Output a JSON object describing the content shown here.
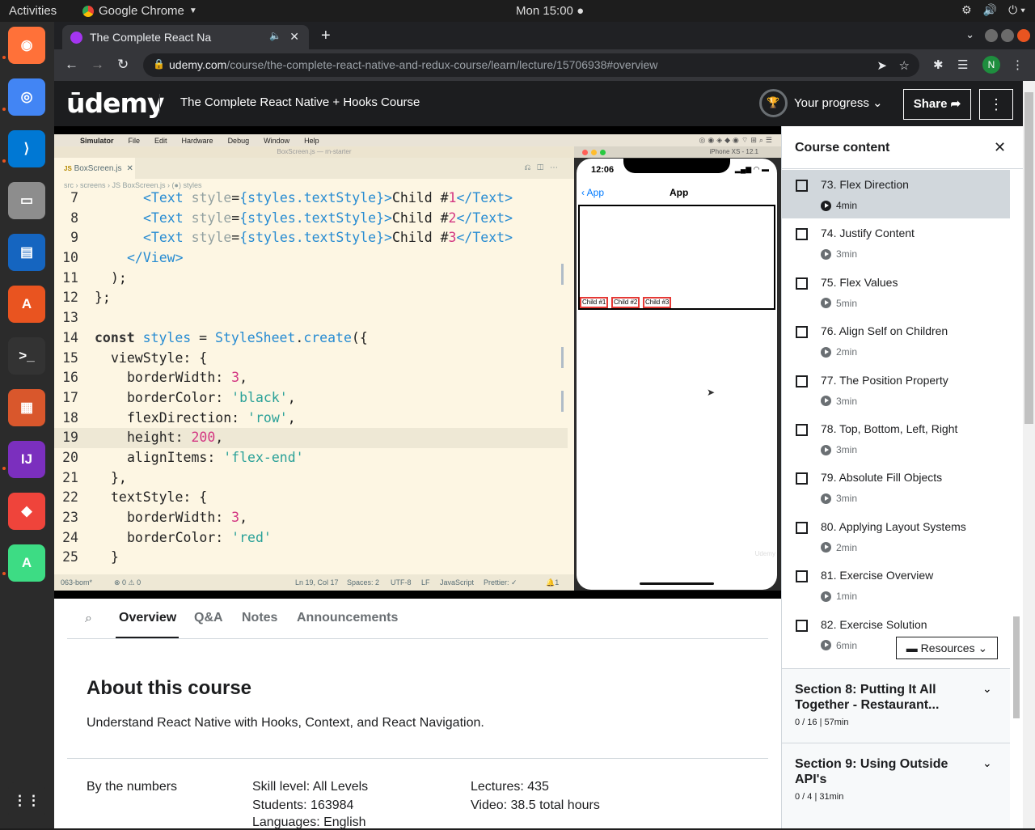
{
  "desktop": {
    "activities": "Activities",
    "app_name": "Google Chrome",
    "clock": "Mon 15:00",
    "dock": [
      {
        "name": "firefox-icon",
        "color": "#ff7139"
      },
      {
        "name": "chrome-icon",
        "color": "#4285f4"
      },
      {
        "name": "vscode-icon",
        "color": "#0078d4"
      },
      {
        "name": "files-icon",
        "color": "#8d8d8d"
      },
      {
        "name": "writer-icon",
        "color": "#1565c0"
      },
      {
        "name": "software-center-icon",
        "color": "#e95420"
      },
      {
        "name": "terminal-icon",
        "color": "#333333"
      },
      {
        "name": "archive-manager-icon",
        "color": "#d9572c"
      },
      {
        "name": "intellij-icon",
        "color": "#7b2fbe"
      },
      {
        "name": "anydesk-icon",
        "color": "#ef443b"
      },
      {
        "name": "android-studio-icon",
        "color": "#3ddc84"
      },
      {
        "name": "show-apps-icon",
        "color": "#2b2b2b"
      }
    ]
  },
  "browser": {
    "tab_title": "The Complete React Na",
    "new_tab": "+",
    "url_host": "udemy.com",
    "url_path": "/course/the-complete-react-native-and-redux-course/learn/lecture/15706938#overview",
    "profile_initial": "N"
  },
  "header": {
    "logo": "ūdemy",
    "course_title": "The Complete React Native + Hooks Course",
    "progress_label": "Your progress",
    "share_label": "Share"
  },
  "video": {
    "menubar": [
      "Simulator",
      "File",
      "Edit",
      "Hardware",
      "Debug",
      "Window",
      "Help"
    ],
    "editor_window_title": "BoxScreen.js — rn-starter",
    "editor_tab": "BoxScreen.js",
    "breadcrumb": "src › screens › JS BoxScreen.js › (●) styles",
    "code_lines": [
      {
        "n": "7",
        "text": "<Text style={styles.textStyle}>Child #1</Text>"
      },
      {
        "n": "8",
        "text": "<Text style={styles.textStyle}>Child #2</Text>"
      },
      {
        "n": "9",
        "text": "<Text style={styles.textStyle}>Child #3</Text>"
      },
      {
        "n": "10",
        "text": "</View>"
      },
      {
        "n": "11",
        "text": ");"
      },
      {
        "n": "12",
        "text": "};"
      },
      {
        "n": "13",
        "text": ""
      },
      {
        "n": "14",
        "text": "const styles = StyleSheet.create({"
      },
      {
        "n": "15",
        "text": "viewStyle: {"
      },
      {
        "n": "16",
        "text": "borderWidth: 3,"
      },
      {
        "n": "17",
        "text": "borderColor: 'black',"
      },
      {
        "n": "18",
        "text": "flexDirection: 'row',"
      },
      {
        "n": "19",
        "text": "height: 200,"
      },
      {
        "n": "20",
        "text": "alignItems: 'flex-end'"
      },
      {
        "n": "21",
        "text": "},"
      },
      {
        "n": "22",
        "text": "textStyle: {"
      },
      {
        "n": "23",
        "text": "borderWidth: 3,"
      },
      {
        "n": "24",
        "text": "borderColor: 'red'"
      },
      {
        "n": "25",
        "text": "}"
      }
    ],
    "status": {
      "branch": "063-bom*",
      "problems": "⊗ 0 ⚠ 0",
      "position": "Ln 19, Col 17",
      "spaces": "Spaces: 2",
      "encoding": "UTF-8",
      "eol": "LF",
      "language": "JavaScript",
      "prettier": "Prettier: ✓",
      "bell": "🔔1"
    },
    "simulator_title": "iPhone XS - 12.1",
    "phone_time": "12:06",
    "phone_back": "App",
    "phone_title": "App",
    "children": [
      "Child #1",
      "Child #2",
      "Child #3"
    ],
    "watermark": "Udemy"
  },
  "tabs": [
    "Overview",
    "Q&A",
    "Notes",
    "Announcements"
  ],
  "about": {
    "heading": "About this course",
    "description": "Understand React Native with Hooks, Context, and React Navigation.",
    "by_numbers": "By the numbers",
    "skill": "Skill level: All Levels",
    "students": "Students: 163984",
    "languages": "Languages: English",
    "lectures": "Lectures: 435",
    "video": "Video: 38.5 total hours"
  },
  "sidebar": {
    "title": "Course content",
    "lectures": [
      {
        "title": "73. Flex Direction",
        "duration": "4min",
        "active": true
      },
      {
        "title": "74. Justify Content",
        "duration": "3min"
      },
      {
        "title": "75. Flex Values",
        "duration": "5min"
      },
      {
        "title": "76. Align Self on Children",
        "duration": "2min"
      },
      {
        "title": "77. The Position Property",
        "duration": "3min"
      },
      {
        "title": "78. Top, Bottom, Left, Right",
        "duration": "3min"
      },
      {
        "title": "79. Absolute Fill Objects",
        "duration": "3min"
      },
      {
        "title": "80. Applying Layout Systems",
        "duration": "2min"
      },
      {
        "title": "81. Exercise Overview",
        "duration": "1min"
      },
      {
        "title": "82. Exercise Solution",
        "duration": "6min"
      }
    ],
    "resources_label": "Resources",
    "sections": [
      {
        "title": "Section 8: Putting It All Together - Restaurant...",
        "meta": "0 / 16 | 57min"
      },
      {
        "title": "Section 9: Using Outside API's",
        "meta": "0 / 4 | 31min"
      }
    ]
  }
}
